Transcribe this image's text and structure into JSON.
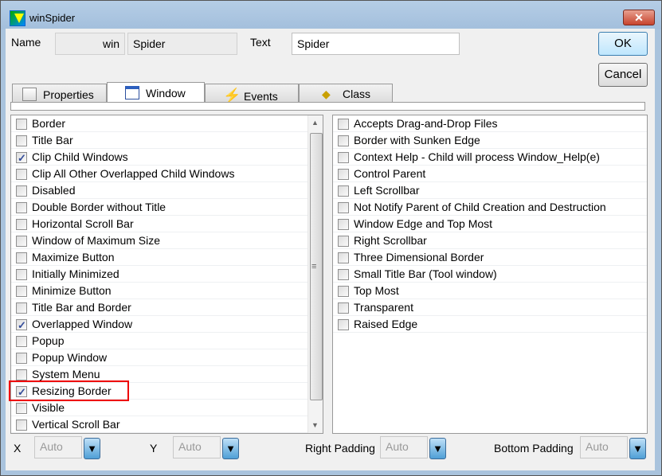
{
  "window": {
    "title": "winSpider",
    "close": "✕"
  },
  "name": {
    "label": "Name",
    "prefix": "win",
    "value": "Spider"
  },
  "text": {
    "label": "Text",
    "value": "Spider"
  },
  "buttons": {
    "ok": "OK",
    "cancel": "Cancel"
  },
  "tabs": [
    {
      "label": "Properties",
      "icon": "properties-icon"
    },
    {
      "label": "Window",
      "icon": "window-icon",
      "active": true
    },
    {
      "label": "Events",
      "icon": "lightning-icon"
    },
    {
      "label": "Class",
      "icon": "class-icon"
    }
  ],
  "left_items": [
    {
      "label": "Border",
      "checked": false
    },
    {
      "label": "Title Bar",
      "checked": false
    },
    {
      "label": "Clip Child Windows",
      "checked": true
    },
    {
      "label": "Clip All Other Overlapped Child Windows",
      "checked": false
    },
    {
      "label": "Disabled",
      "checked": false
    },
    {
      "label": "Double Border without Title",
      "checked": false
    },
    {
      "label": "Horizontal Scroll Bar",
      "checked": false
    },
    {
      "label": "Window of Maximum Size",
      "checked": false
    },
    {
      "label": "Maximize Button",
      "checked": false
    },
    {
      "label": "Initially Minimized",
      "checked": false
    },
    {
      "label": "Minimize Button",
      "checked": false
    },
    {
      "label": "Title Bar and Border",
      "checked": false
    },
    {
      "label": "Overlapped Window",
      "checked": true
    },
    {
      "label": "Popup",
      "checked": false
    },
    {
      "label": "Popup Window",
      "checked": false
    },
    {
      "label": "System Menu",
      "checked": false
    },
    {
      "label": "Resizing Border",
      "checked": true
    },
    {
      "label": "Visible",
      "checked": false
    },
    {
      "label": "Vertical Scroll Bar",
      "checked": false
    }
  ],
  "right_items": [
    {
      "label": "Accepts Drag-and-Drop Files",
      "checked": false
    },
    {
      "label": "Border with Sunken Edge",
      "checked": false
    },
    {
      "label": "Context Help - Child will process Window_Help(e)",
      "checked": false
    },
    {
      "label": "Control Parent",
      "checked": false
    },
    {
      "label": "Left Scrollbar",
      "checked": false
    },
    {
      "label": "Not Notify Parent of Child Creation and Destruction",
      "checked": false
    },
    {
      "label": "Window Edge and Top Most",
      "checked": false
    },
    {
      "label": "Right Scrollbar",
      "checked": false
    },
    {
      "label": "Three Dimensional Border",
      "checked": false
    },
    {
      "label": "Small Title Bar (Tool window)",
      "checked": false
    },
    {
      "label": "Top Most",
      "checked": false
    },
    {
      "label": "Transparent",
      "checked": false
    },
    {
      "label": "Raised Edge",
      "checked": false
    }
  ],
  "bottom": [
    {
      "label": "X",
      "value": "Auto"
    },
    {
      "label": "Y",
      "value": "Auto"
    },
    {
      "label": "Right Padding",
      "value": "Auto"
    },
    {
      "label": "Bottom Padding",
      "value": "Auto"
    }
  ],
  "highlight_color": "#e00000"
}
